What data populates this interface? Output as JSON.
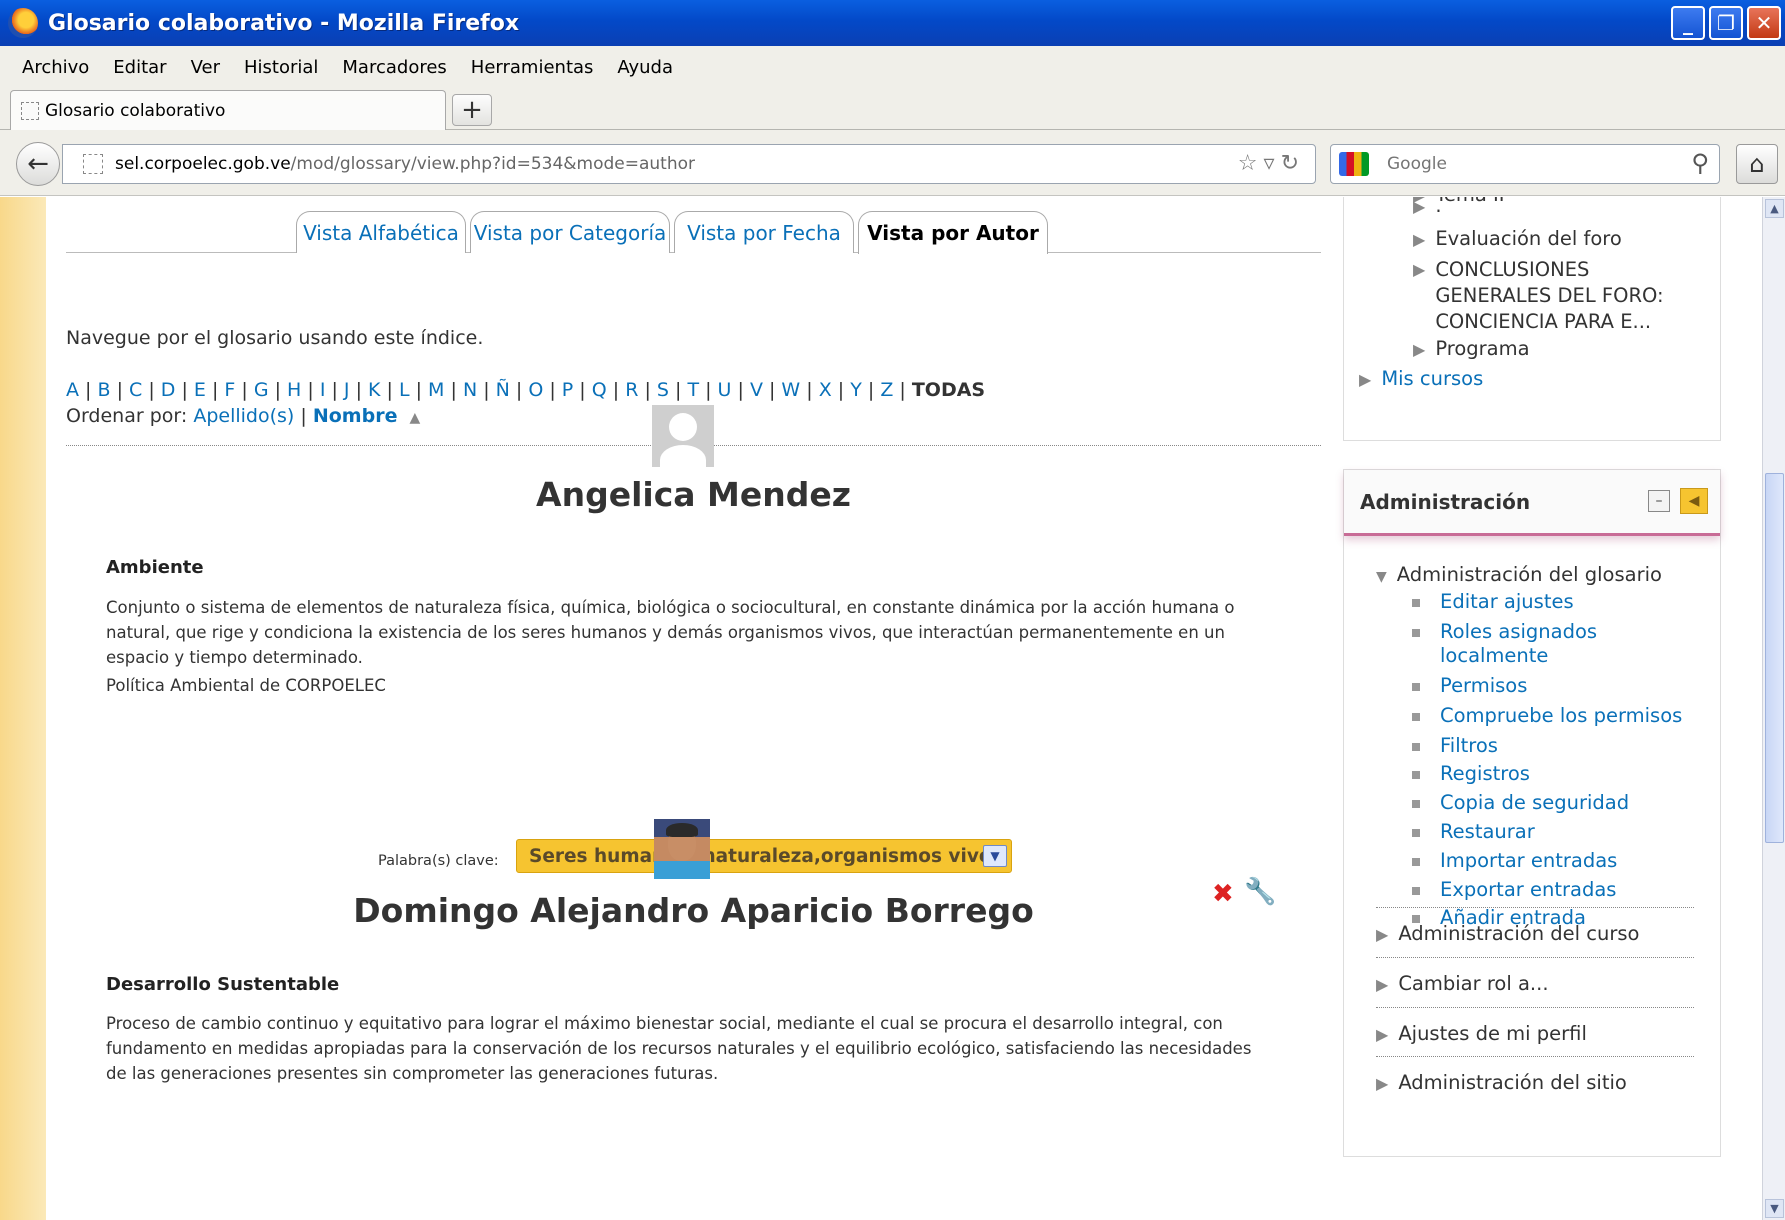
{
  "window": {
    "title": "Glosario colaborativo - Mozilla Firefox",
    "buttons": [
      "_",
      "❐",
      "✕"
    ]
  },
  "menu": [
    "Archivo",
    "Editar",
    "Ver",
    "Historial",
    "Marcadores",
    "Herramientas",
    "Ayuda"
  ],
  "browser_tab": {
    "label": "Glosario colaborativo",
    "new_tab": "+"
  },
  "address": {
    "url_host": "sel.corpoelec.gob.ve",
    "url_path": "/mod/glossary/view.php?id=534&mode=author",
    "search_placeholder": "Google"
  },
  "view_tabs": [
    "Vista Alfabética",
    "Vista por Categoría",
    "Vista por Fecha",
    "Vista por Autor"
  ],
  "active_view_tab": "Vista por Autor",
  "intro": "Navegue por el glosario usando este índice.",
  "alphabet": [
    "A",
    "B",
    "C",
    "D",
    "E",
    "F",
    "G",
    "H",
    "I",
    "J",
    "K",
    "L",
    "M",
    "N",
    "Ñ",
    "O",
    "P",
    "Q",
    "R",
    "S",
    "T",
    "U",
    "V",
    "W",
    "X",
    "Y",
    "Z"
  ],
  "alphabet_all": "TODAS",
  "sort": {
    "label": "Ordenar por:",
    "surname": "Apellido(s)",
    "name": "Nombre"
  },
  "entries": [
    {
      "author": "Angelica Mendez",
      "concept": "Ambiente",
      "definition": "Conjunto o sistema de elementos de naturaleza física, química, biológica o sociocultural, en constante dinámica por la acción humana o natural, que rige y condiciona la existencia de los seres humanos y demás organismos vivos, que interactúan permanentemente en un espacio y tiempo determinado.",
      "source": "Política Ambiental de CORPOELEC",
      "keywords_label": "Palabra(s) clave:",
      "keywords": "Seres humanos, naturaleza,organismos vivos"
    },
    {
      "author": "Domingo Alejandro Aparicio Borrego",
      "concept": "Desarrollo Sustentable",
      "definition": "Proceso de cambio continuo y equitativo para lograr el máximo bienestar social, mediante el cual se procura el desarrollo integral, con fundamento en medidas apropiadas para la conservación de los recursos naturales y el equilibrio ecológico, satisfaciendo las necesidades de las generaciones presentes sin comprometer las generaciones futuras."
    }
  ],
  "nav_block": {
    "items": [
      "Tema II",
      ".",
      "Evaluación del foro",
      "CONCLUSIONES GENERALES DEL FORO: CONCIENCIA PARA E...",
      "Programa"
    ],
    "my_courses": "Mis cursos"
  },
  "admin": {
    "title": "Administración",
    "glossary_admin": "Administración del glosario",
    "items": [
      "Editar ajustes",
      "Roles asignados localmente",
      "Permisos",
      "Compruebe los permisos",
      "Filtros",
      "Registros",
      "Copia de seguridad",
      "Restaurar",
      "Importar entradas",
      "Exportar entradas",
      "Añadir entrada"
    ],
    "sections": [
      "Administración del curso",
      "Cambiar rol a...",
      "Ajustes de mi perfil",
      "Administración del sitio"
    ]
  },
  "colors": {
    "link": "#0a70b8",
    "keyword_bg": "#f6c430",
    "titlebar": "#0349c8",
    "admin_accent": "#c86b96"
  }
}
